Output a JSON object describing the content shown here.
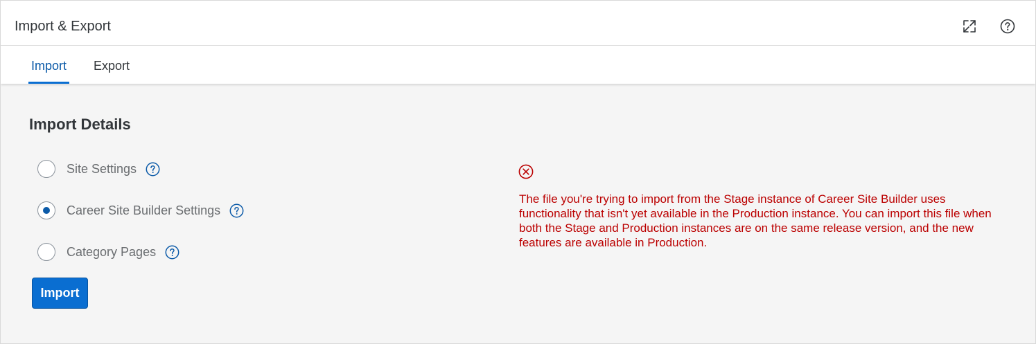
{
  "header": {
    "title": "Import & Export",
    "expand_icon": "expand-icon",
    "help_icon": "help-icon"
  },
  "tabs": [
    {
      "label": "Import",
      "selected": true
    },
    {
      "label": "Export",
      "selected": false
    }
  ],
  "import_details": {
    "title": "Import Details",
    "options": [
      {
        "label": "Site Settings",
        "selected": false,
        "icon": "help-icon"
      },
      {
        "label": "Career Site Builder Settings",
        "selected": true,
        "icon": "help-icon"
      },
      {
        "label": "Category Pages",
        "selected": false,
        "icon": "help-icon"
      }
    ],
    "import_button_label": "Import"
  },
  "error": {
    "icon": "error-circle-icon",
    "message": "The file you're trying to import from the Stage instance of Career Site Builder uses functionality that isn't yet available in the Production instance. You can import this file when both the Stage and Production instances are on the same release version, and the new features are available in Production."
  },
  "colors": {
    "accent": "#0a6ed1",
    "selected_tab_text": "#0b5aa8",
    "error": "#bb0000",
    "content_background": "#f5f5f5",
    "text": "#32363a",
    "muted_text": "#6a6d70"
  }
}
